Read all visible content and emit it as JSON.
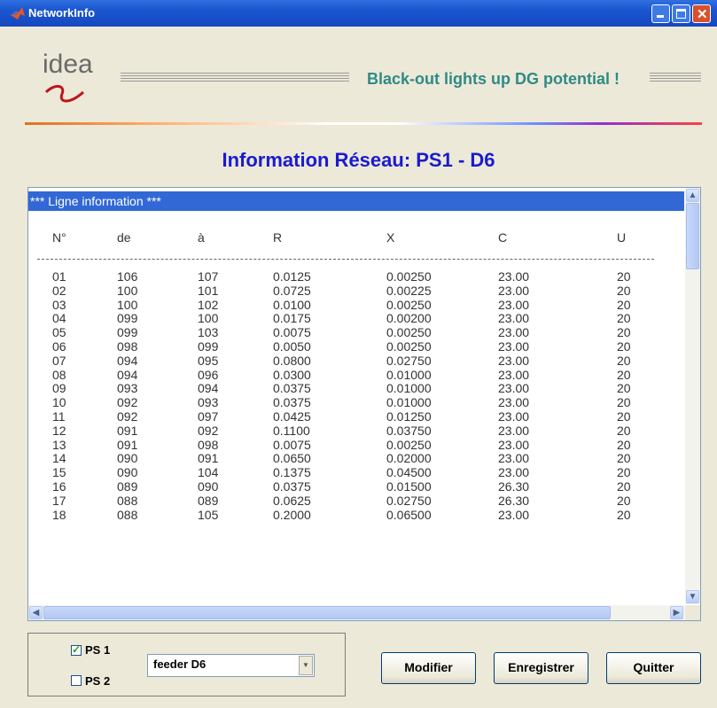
{
  "window": {
    "title": "NetworkInfo"
  },
  "header": {
    "logo_text": "idea",
    "slogan": "Black-out lights up DG potential !"
  },
  "page_title": "Information Réseau: PS1 - D6",
  "table": {
    "selected_line": "*** Ligne information ***",
    "columns": [
      "N°",
      "de",
      "à",
      "R",
      "X",
      "C",
      "U"
    ],
    "rows": [
      [
        "01",
        "106",
        "107",
        "0.0125",
        "0.00250",
        "23.00",
        "20"
      ],
      [
        "02",
        "100",
        "101",
        "0.0725",
        "0.00225",
        "23.00",
        "20"
      ],
      [
        "03",
        "100",
        "102",
        "0.0100",
        "0.00250",
        "23.00",
        "20"
      ],
      [
        "04",
        "099",
        "100",
        "0.0175",
        "0.00200",
        "23.00",
        "20"
      ],
      [
        "05",
        "099",
        "103",
        "0.0075",
        "0.00250",
        "23.00",
        "20"
      ],
      [
        "06",
        "098",
        "099",
        "0.0050",
        "0.00250",
        "23.00",
        "20"
      ],
      [
        "07",
        "094",
        "095",
        "0.0800",
        "0.02750",
        "23.00",
        "20"
      ],
      [
        "08",
        "094",
        "096",
        "0.0300",
        "0.01000",
        "23.00",
        "20"
      ],
      [
        "09",
        "093",
        "094",
        "0.0375",
        "0.01000",
        "23.00",
        "20"
      ],
      [
        "10",
        "092",
        "093",
        "0.0375",
        "0.01000",
        "23.00",
        "20"
      ],
      [
        "11",
        "092",
        "097",
        "0.0425",
        "0.01250",
        "23.00",
        "20"
      ],
      [
        "12",
        "091",
        "092",
        "0.1100",
        "0.03750",
        "23.00",
        "20"
      ],
      [
        "13",
        "091",
        "098",
        "0.0075",
        "0.00250",
        "23.00",
        "20"
      ],
      [
        "14",
        "090",
        "091",
        "0.0650",
        "0.02000",
        "23.00",
        "20"
      ],
      [
        "15",
        "090",
        "104",
        "0.1375",
        "0.04500",
        "23.00",
        "20"
      ],
      [
        "16",
        "089",
        "090",
        "0.0375",
        "0.01500",
        "26.30",
        "20"
      ],
      [
        "17",
        "088",
        "089",
        "0.0625",
        "0.02750",
        "26.30",
        "20"
      ],
      [
        "18",
        "088",
        "105",
        "0.2000",
        "0.06500",
        "23.00",
        "20"
      ]
    ]
  },
  "controls": {
    "ps1": {
      "label": "PS 1",
      "checked": true
    },
    "ps2": {
      "label": "PS 2",
      "checked": false
    },
    "feeder_select": "feeder D6",
    "modify_label": "Modifier",
    "save_label": "Enregistrer",
    "quit_label": "Quitter"
  }
}
